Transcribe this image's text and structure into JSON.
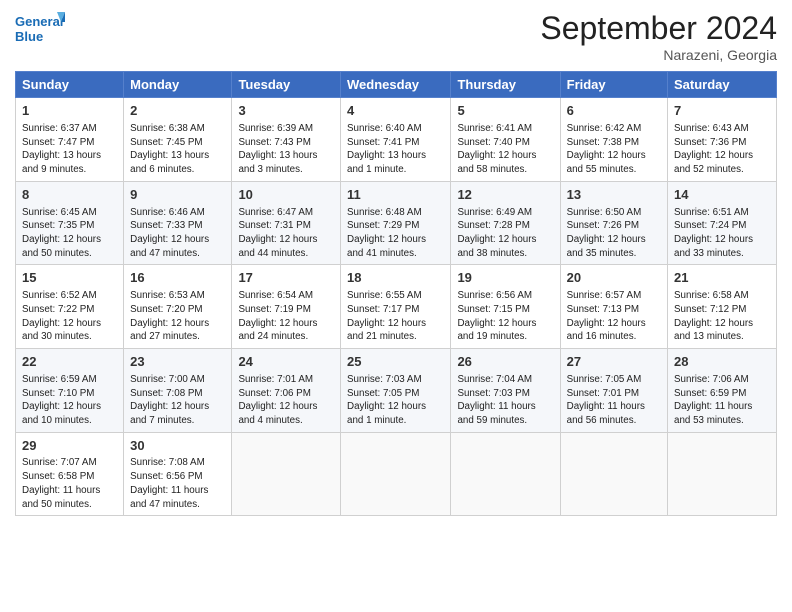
{
  "logo": {
    "line1": "General",
    "line2": "Blue"
  },
  "title": "September 2024",
  "location": "Narazeni, Georgia",
  "headers": [
    "Sunday",
    "Monday",
    "Tuesday",
    "Wednesday",
    "Thursday",
    "Friday",
    "Saturday"
  ],
  "weeks": [
    [
      {
        "day": "1",
        "info": "Sunrise: 6:37 AM\nSunset: 7:47 PM\nDaylight: 13 hours\nand 9 minutes."
      },
      {
        "day": "2",
        "info": "Sunrise: 6:38 AM\nSunset: 7:45 PM\nDaylight: 13 hours\nand 6 minutes."
      },
      {
        "day": "3",
        "info": "Sunrise: 6:39 AM\nSunset: 7:43 PM\nDaylight: 13 hours\nand 3 minutes."
      },
      {
        "day": "4",
        "info": "Sunrise: 6:40 AM\nSunset: 7:41 PM\nDaylight: 13 hours\nand 1 minute."
      },
      {
        "day": "5",
        "info": "Sunrise: 6:41 AM\nSunset: 7:40 PM\nDaylight: 12 hours\nand 58 minutes."
      },
      {
        "day": "6",
        "info": "Sunrise: 6:42 AM\nSunset: 7:38 PM\nDaylight: 12 hours\nand 55 minutes."
      },
      {
        "day": "7",
        "info": "Sunrise: 6:43 AM\nSunset: 7:36 PM\nDaylight: 12 hours\nand 52 minutes."
      }
    ],
    [
      {
        "day": "8",
        "info": "Sunrise: 6:45 AM\nSunset: 7:35 PM\nDaylight: 12 hours\nand 50 minutes."
      },
      {
        "day": "9",
        "info": "Sunrise: 6:46 AM\nSunset: 7:33 PM\nDaylight: 12 hours\nand 47 minutes."
      },
      {
        "day": "10",
        "info": "Sunrise: 6:47 AM\nSunset: 7:31 PM\nDaylight: 12 hours\nand 44 minutes."
      },
      {
        "day": "11",
        "info": "Sunrise: 6:48 AM\nSunset: 7:29 PM\nDaylight: 12 hours\nand 41 minutes."
      },
      {
        "day": "12",
        "info": "Sunrise: 6:49 AM\nSunset: 7:28 PM\nDaylight: 12 hours\nand 38 minutes."
      },
      {
        "day": "13",
        "info": "Sunrise: 6:50 AM\nSunset: 7:26 PM\nDaylight: 12 hours\nand 35 minutes."
      },
      {
        "day": "14",
        "info": "Sunrise: 6:51 AM\nSunset: 7:24 PM\nDaylight: 12 hours\nand 33 minutes."
      }
    ],
    [
      {
        "day": "15",
        "info": "Sunrise: 6:52 AM\nSunset: 7:22 PM\nDaylight: 12 hours\nand 30 minutes."
      },
      {
        "day": "16",
        "info": "Sunrise: 6:53 AM\nSunset: 7:20 PM\nDaylight: 12 hours\nand 27 minutes."
      },
      {
        "day": "17",
        "info": "Sunrise: 6:54 AM\nSunset: 7:19 PM\nDaylight: 12 hours\nand 24 minutes."
      },
      {
        "day": "18",
        "info": "Sunrise: 6:55 AM\nSunset: 7:17 PM\nDaylight: 12 hours\nand 21 minutes."
      },
      {
        "day": "19",
        "info": "Sunrise: 6:56 AM\nSunset: 7:15 PM\nDaylight: 12 hours\nand 19 minutes."
      },
      {
        "day": "20",
        "info": "Sunrise: 6:57 AM\nSunset: 7:13 PM\nDaylight: 12 hours\nand 16 minutes."
      },
      {
        "day": "21",
        "info": "Sunrise: 6:58 AM\nSunset: 7:12 PM\nDaylight: 12 hours\nand 13 minutes."
      }
    ],
    [
      {
        "day": "22",
        "info": "Sunrise: 6:59 AM\nSunset: 7:10 PM\nDaylight: 12 hours\nand 10 minutes."
      },
      {
        "day": "23",
        "info": "Sunrise: 7:00 AM\nSunset: 7:08 PM\nDaylight: 12 hours\nand 7 minutes."
      },
      {
        "day": "24",
        "info": "Sunrise: 7:01 AM\nSunset: 7:06 PM\nDaylight: 12 hours\nand 4 minutes."
      },
      {
        "day": "25",
        "info": "Sunrise: 7:03 AM\nSunset: 7:05 PM\nDaylight: 12 hours\nand 1 minute."
      },
      {
        "day": "26",
        "info": "Sunrise: 7:04 AM\nSunset: 7:03 PM\nDaylight: 11 hours\nand 59 minutes."
      },
      {
        "day": "27",
        "info": "Sunrise: 7:05 AM\nSunset: 7:01 PM\nDaylight: 11 hours\nand 56 minutes."
      },
      {
        "day": "28",
        "info": "Sunrise: 7:06 AM\nSunset: 6:59 PM\nDaylight: 11 hours\nand 53 minutes."
      }
    ],
    [
      {
        "day": "29",
        "info": "Sunrise: 7:07 AM\nSunset: 6:58 PM\nDaylight: 11 hours\nand 50 minutes."
      },
      {
        "day": "30",
        "info": "Sunrise: 7:08 AM\nSunset: 6:56 PM\nDaylight: 11 hours\nand 47 minutes."
      },
      {
        "day": "",
        "info": ""
      },
      {
        "day": "",
        "info": ""
      },
      {
        "day": "",
        "info": ""
      },
      {
        "day": "",
        "info": ""
      },
      {
        "day": "",
        "info": ""
      }
    ]
  ]
}
